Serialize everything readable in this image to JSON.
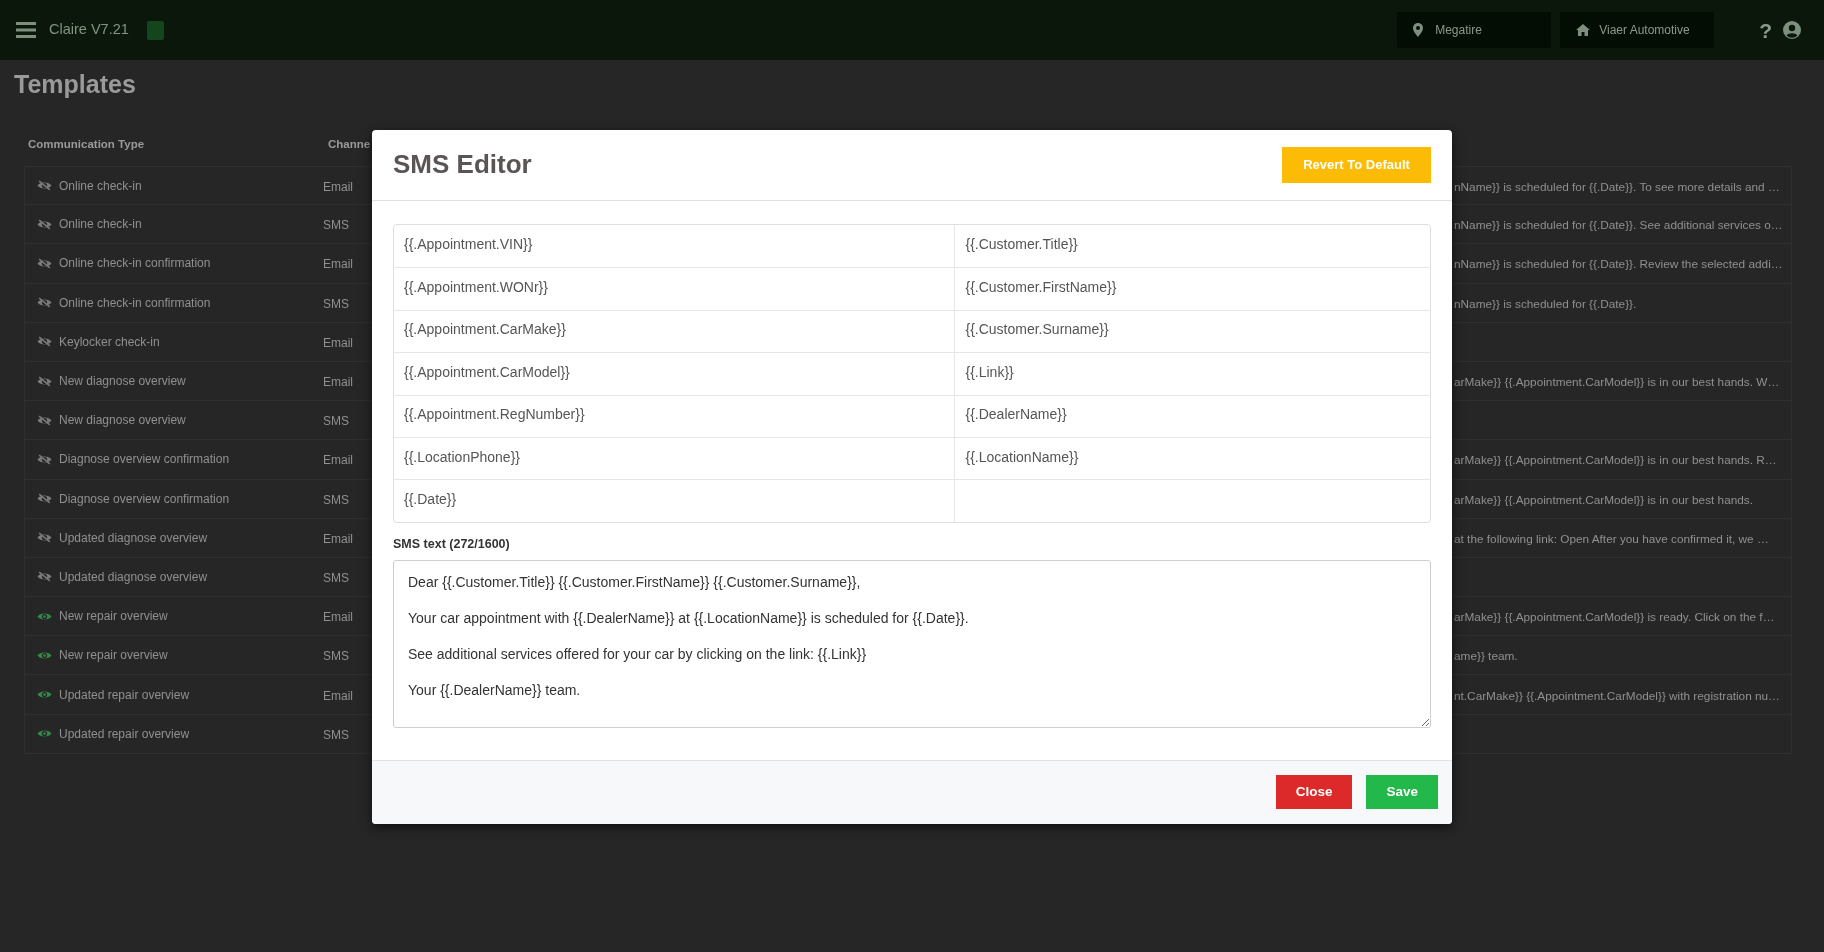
{
  "navbar": {
    "title": "Claire V7.21",
    "location": "Megatire",
    "company": "Viaer Automotive",
    "help": "?"
  },
  "page": {
    "title": "Templates"
  },
  "table": {
    "columns": [
      "Communication Type",
      "Channe"
    ],
    "rows": [
      {
        "visible": false,
        "communication_type": "Online check-in",
        "channel": "Email",
        "column_3": "nName}} is scheduled for {{.Date}}. To see more details and …"
      },
      {
        "visible": false,
        "communication_type": "Online check-in",
        "channel": "SMS",
        "column_3": "nName}} is scheduled for {{.Date}}. See additional services o…"
      },
      {
        "visible": false,
        "communication_type": "Online check-in confirmation",
        "channel": "Email",
        "column_3": "nName}} is scheduled for {{.Date}}. Review the selected addi…"
      },
      {
        "visible": false,
        "communication_type": "Online check-in confirmation",
        "channel": "SMS",
        "column_3": "nName}} is scheduled for {{.Date}}."
      },
      {
        "visible": false,
        "communication_type": "Keylocker check-in",
        "channel": "Email"
      },
      {
        "visible": false,
        "communication_type": "New diagnose overview",
        "channel": "Email",
        "column_3": "arMake}} {{.Appointment.CarModel}} is in our best hands. W…"
      },
      {
        "visible": false,
        "communication_type": "New diagnose overview",
        "channel": "SMS"
      },
      {
        "visible": false,
        "communication_type": "Diagnose overview confirmation",
        "channel": "Email",
        "column_3": "arMake}} {{.Appointment.CarModel}} is in our best hands. R…"
      },
      {
        "visible": false,
        "communication_type": "Diagnose overview confirmation",
        "channel": "SMS",
        "column_3": "arMake}} {{.Appointment.CarModel}} is in our best hands."
      },
      {
        "visible": false,
        "communication_type": "Updated diagnose overview",
        "channel": "Email",
        "column_3": "at the following link: Open After you have confirmed it, we …"
      },
      {
        "visible": false,
        "communication_type": "Updated diagnose overview",
        "channel": "SMS"
      },
      {
        "visible": true,
        "communication_type": "New repair overview",
        "channel": "Email",
        "column_3": "arMake}} {{.Appointment.CarModel}} is ready. Click on the f…"
      },
      {
        "visible": true,
        "communication_type": "New repair overview",
        "channel": "SMS",
        "column_3": "ame}} team."
      },
      {
        "visible": true,
        "communication_type": "Updated repair overview",
        "channel": "Email",
        "column_3": "nt.CarMake}} {{.Appointment.CarModel}} with registration nu…"
      },
      {
        "visible": true,
        "communication_type": "Updated repair overview",
        "channel": "SMS"
      }
    ]
  },
  "modal": {
    "title": "SMS Editor",
    "revert_button": "Revert To Default",
    "variables": [
      [
        "{{.Appointment.VIN}}",
        "{{.Customer.Title}}"
      ],
      [
        "{{.Appointment.WONr}}",
        "{{.Customer.FirstName}}"
      ],
      [
        "{{.Appointment.CarMake}}",
        "{{.Customer.Surname}}"
      ],
      [
        "{{.Appointment.CarModel}}",
        "{{.Link}}"
      ],
      [
        "{{.Appointment.RegNumber}}",
        "{{.DealerName}}"
      ],
      [
        "{{.LocationPhone}}",
        "{{.LocationName}}"
      ],
      [
        "{{.Date}}"
      ]
    ],
    "sms_text": {
      "label": "SMS text (272/1600)",
      "value": "Dear {{.Customer.Title}} {{.Customer.FirstName}} {{.Customer.Surname}},\n\nYour car appointment with {{.DealerName}} at {{.LocationName}} is scheduled for {{.Date}}.\n\nSee additional services offered for your car by clicking on the link: {{.Link}}\n\nYour {{.DealerName}} team."
    },
    "buttons": [
      {
        "kind": "danger",
        "label": "Close"
      },
      {
        "kind": "success",
        "label": "Save"
      }
    ]
  }
}
